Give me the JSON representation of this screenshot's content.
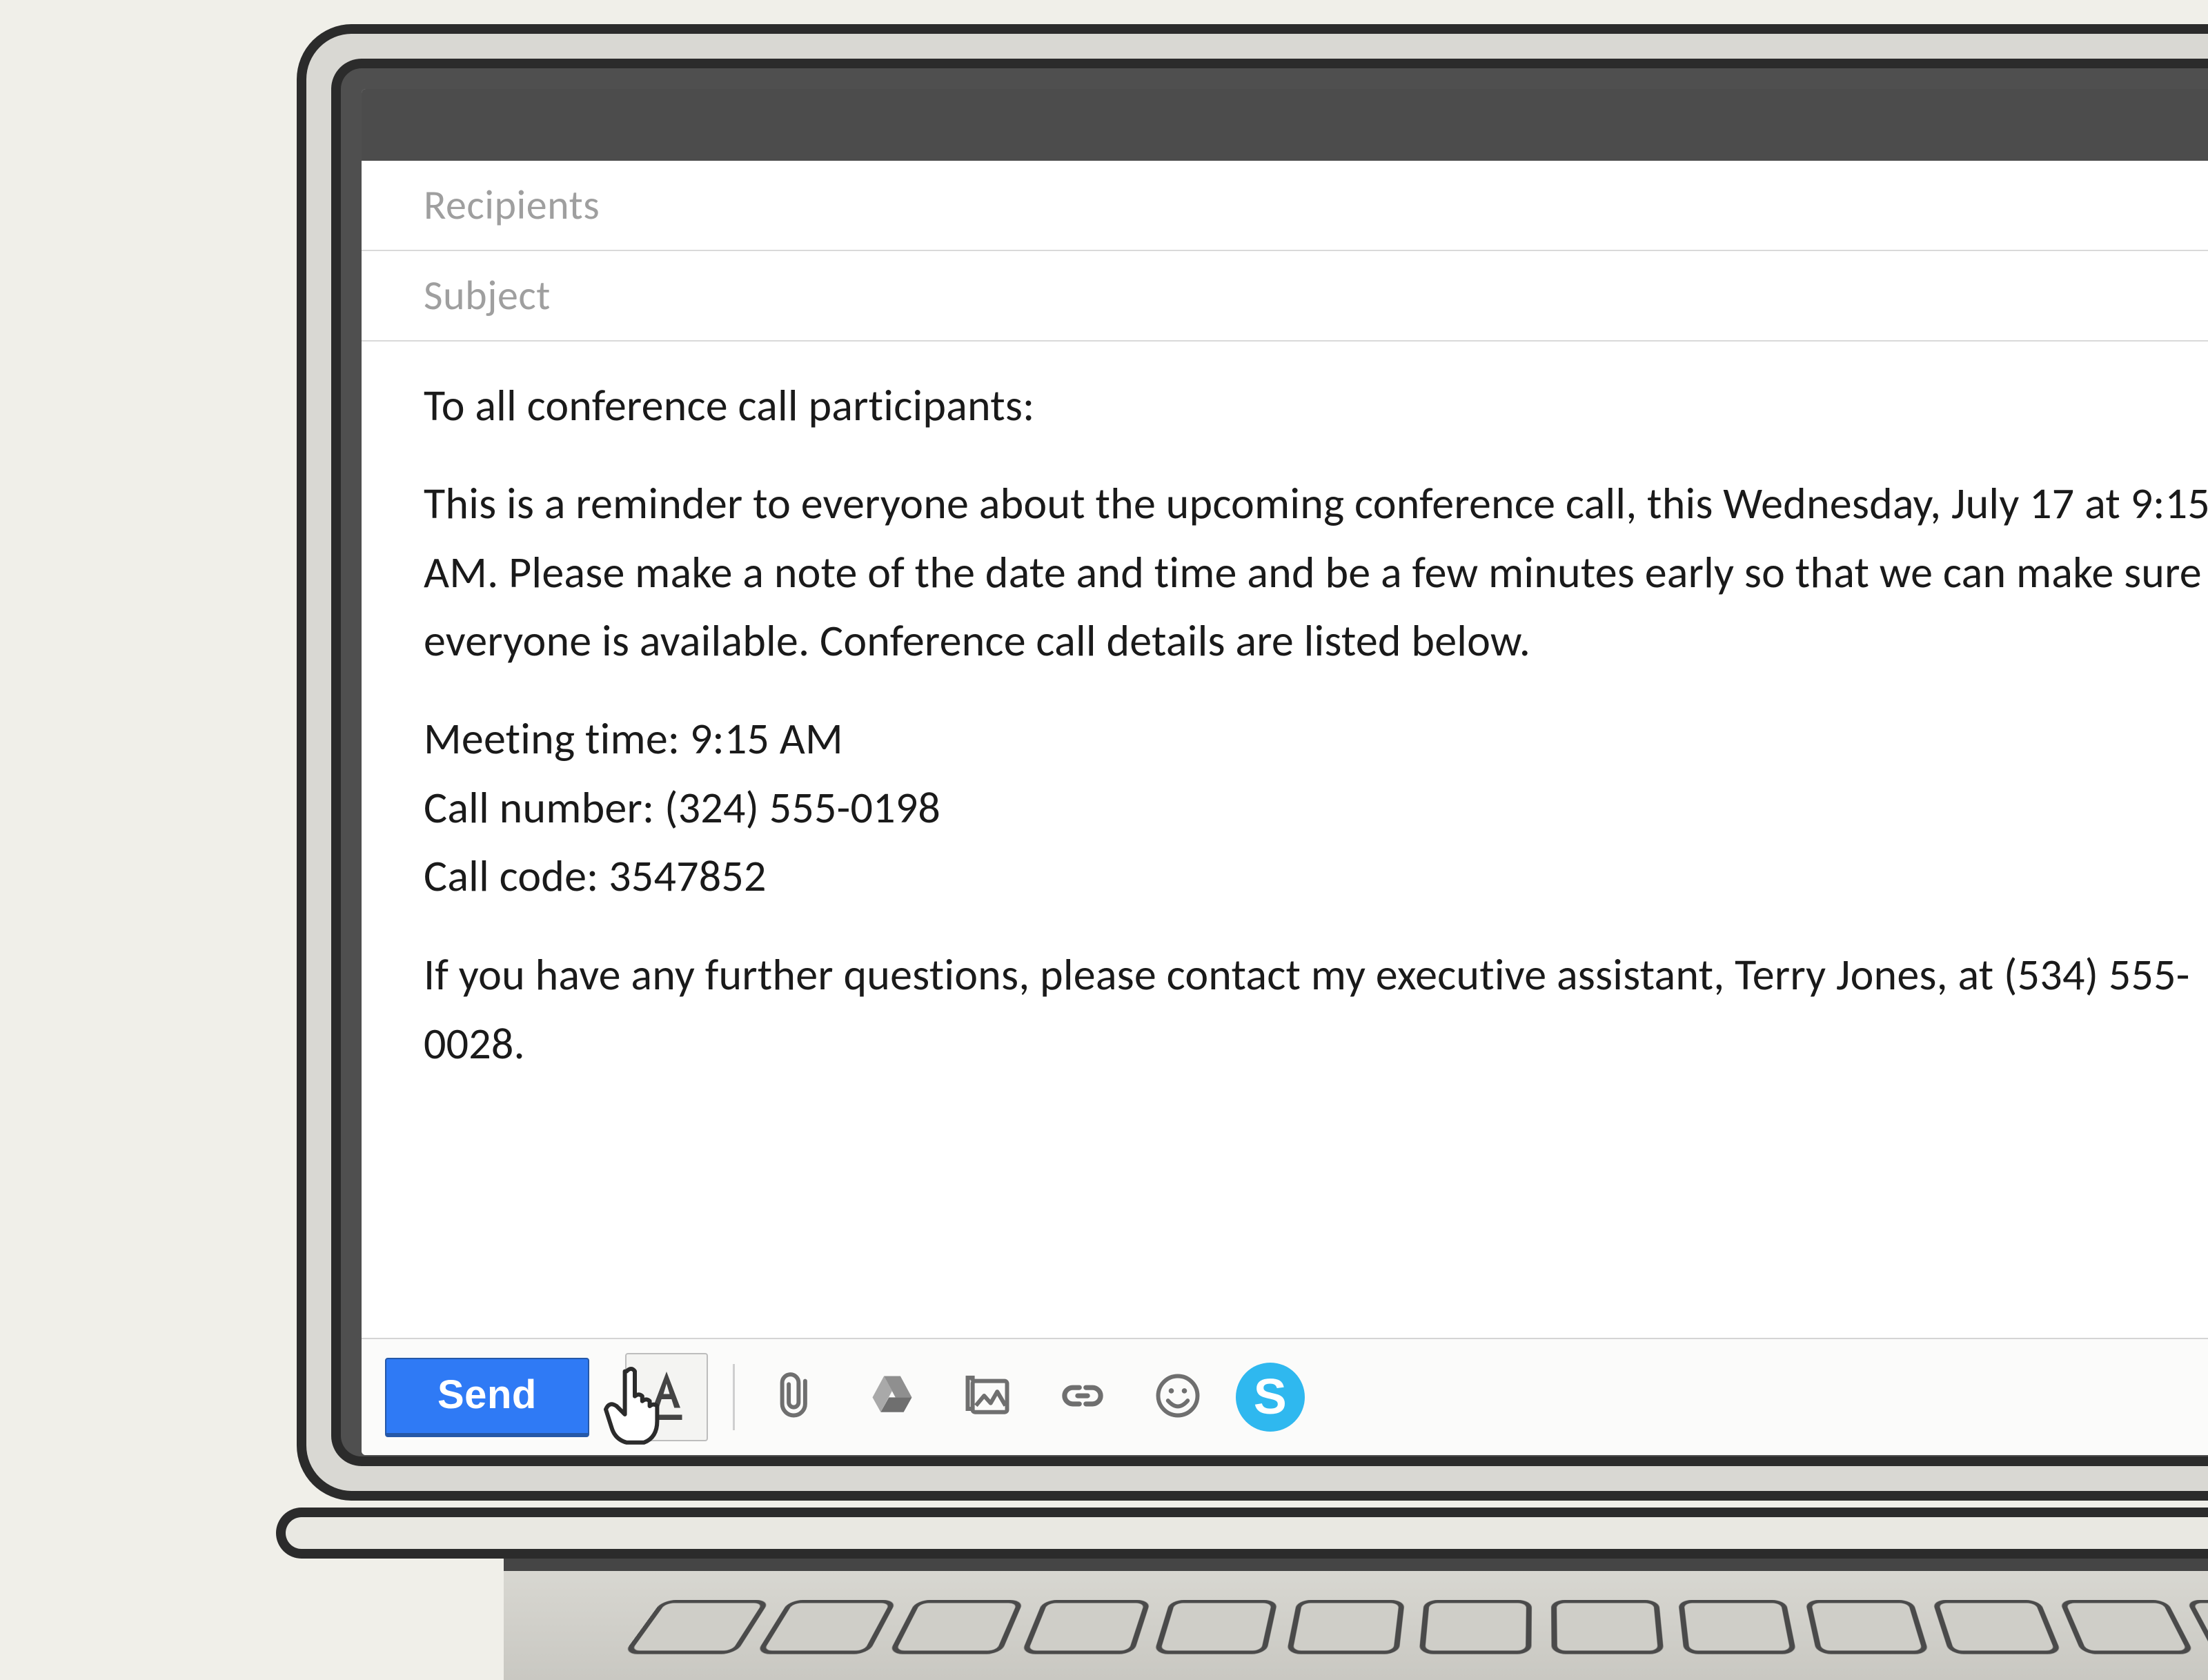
{
  "compose": {
    "recipients_placeholder": "Recipients",
    "subject_placeholder": "Subject",
    "body": {
      "salutation": "To all conference call participants:",
      "paragraph1": "This is a reminder to everyone about the upcoming conference call, this Wednesday, July 17 at 9:15 AM. Please make a note of the date and time and be a few minutes early so that we can make sure everyone is available. Conference call details are listed below.",
      "meeting_time_line": "Meeting time: 9:15 AM",
      "call_number_line": "Call number: (324) 555-0198",
      "call_code_line": "Call code: 3547852",
      "paragraph2": "If you have any further questions, please contact my executive assistant, Terry Jones, at (534) 555-0028."
    }
  },
  "toolbar": {
    "send_label": "Send"
  },
  "icons": {
    "format": "text-format",
    "attach": "paperclip",
    "drive": "drive",
    "image": "image",
    "link": "link",
    "emoji": "emoji",
    "skype": "S"
  }
}
